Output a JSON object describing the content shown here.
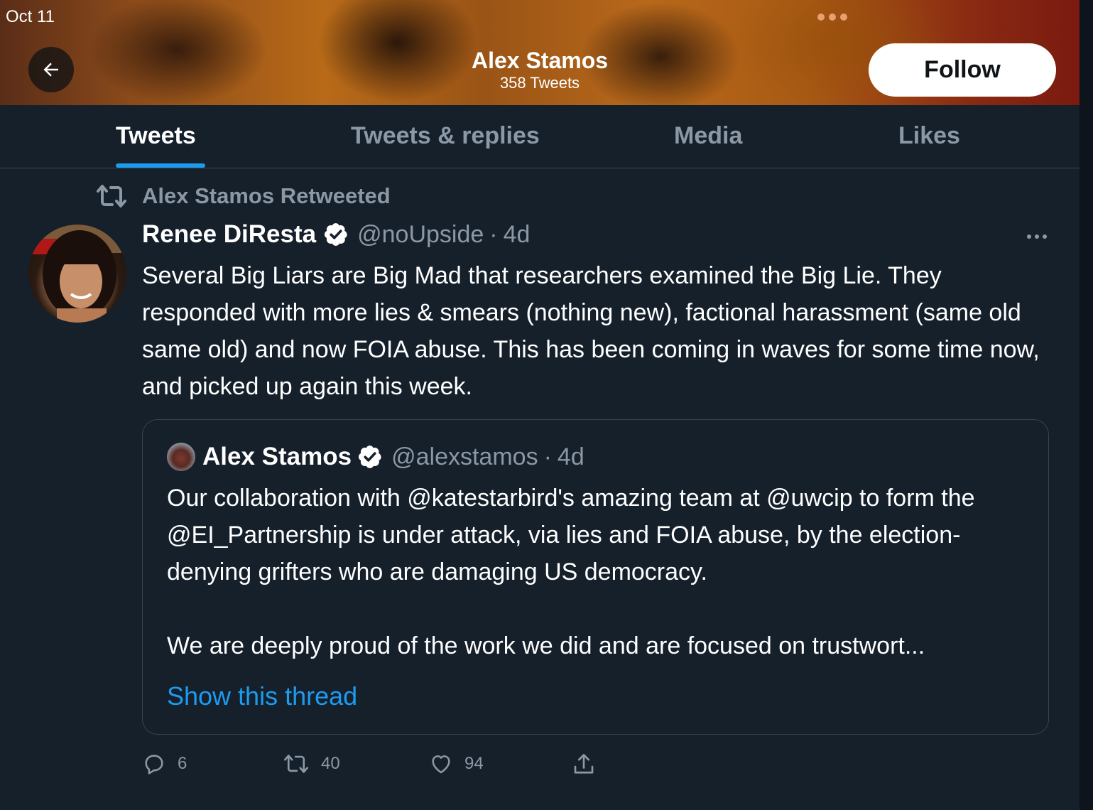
{
  "status_bar": {
    "time": "Oct 11"
  },
  "header": {
    "name": "Alex Stamos",
    "tweet_count": "358 Tweets",
    "follow_label": "Follow"
  },
  "tabs": [
    {
      "label": "Tweets",
      "active": true
    },
    {
      "label": "Tweets & replies",
      "active": false
    },
    {
      "label": "Media",
      "active": false
    },
    {
      "label": "Likes",
      "active": false
    }
  ],
  "tweet": {
    "retweeted_by": "Alex Stamos Retweeted",
    "author_name": "Renee DiResta",
    "handle": "@noUpside",
    "separator": "·",
    "time": "4d",
    "text": "Several Big Liars are Big Mad that researchers examined the Big Lie. They responded with more lies & smears (nothing new), factional harassment (same old same old) and now FOIA abuse. This has been coming in waves for some time now, and picked up again this week.",
    "quote": {
      "author_name": "Alex Stamos",
      "handle": "@alexstamos",
      "separator": "·",
      "time": "4d",
      "paragraph_1": "Our collaboration with @katestarbird's amazing team at @uwcip to form the @EI_Partnership is under attack, via lies and FOIA abuse, by the election-denying grifters who are damaging US democracy.",
      "paragraph_2": "We are deeply proud of the work we did and are focused on trustwort...",
      "show_thread": "Show this thread"
    },
    "actions": {
      "replies": "6",
      "retweets": "40",
      "likes": "94"
    }
  },
  "colors": {
    "background": "#15202b",
    "accent": "#1d9bf0",
    "muted_text": "#8b98a5",
    "border": "#38444d"
  }
}
